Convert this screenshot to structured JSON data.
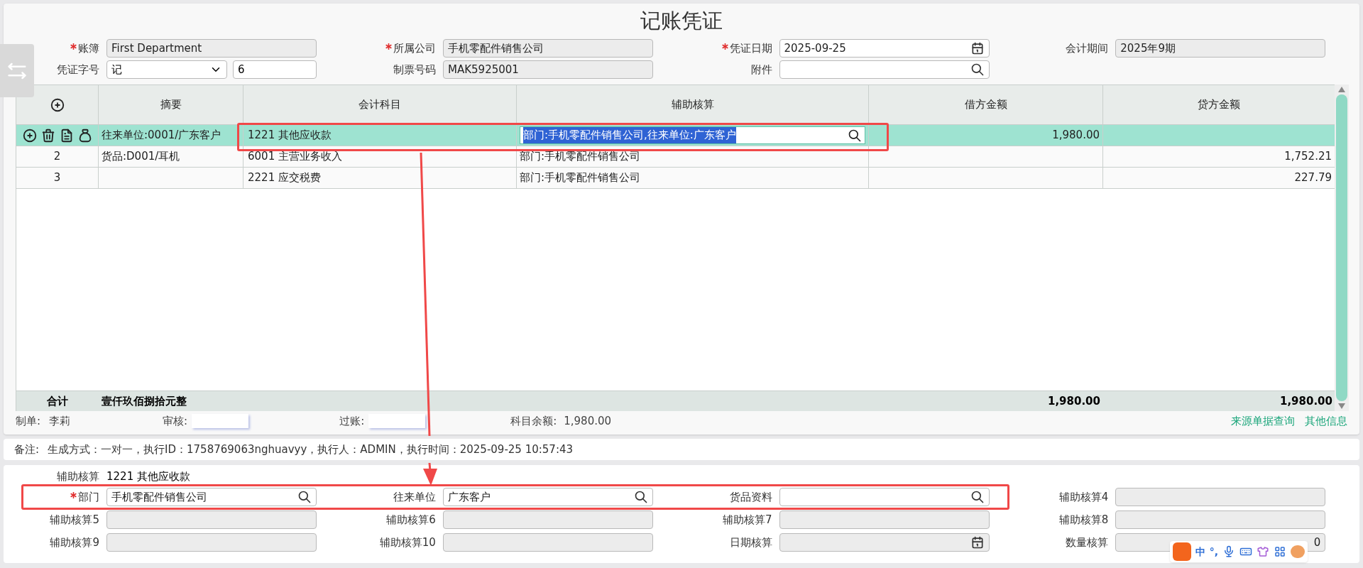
{
  "title": "记账凭证",
  "header_rows": [
    [
      {
        "label": "账簿",
        "required": true,
        "kind": "text",
        "disabled": true,
        "value": "First Department"
      },
      {
        "label": "所属公司",
        "required": true,
        "kind": "text",
        "disabled": true,
        "value": "手机零配件销售公司"
      },
      {
        "label": "凭证日期",
        "required": true,
        "kind": "date",
        "disabled": false,
        "value": "2025-09-25"
      },
      {
        "label": "会计期间",
        "required": false,
        "kind": "text",
        "disabled": true,
        "value": "2025年9期"
      }
    ],
    [
      {
        "label": "凭证字号",
        "required": false,
        "kind": "select_number",
        "disabled": false,
        "value": "记",
        "number": "6"
      },
      {
        "label": "制票号码",
        "required": false,
        "kind": "text",
        "disabled": true,
        "value": "MAK5925001"
      },
      {
        "label": "附件",
        "required": false,
        "kind": "lookup",
        "disabled": false
      }
    ]
  ],
  "table": {
    "columns": [
      "摘要",
      "会计科目",
      "辅助核算",
      "借方金额",
      "贷方金额"
    ],
    "rows": [
      {
        "selected": true,
        "index": "",
        "summary": "往来单位:0001/广东客户",
        "account": "1221 其他应收款",
        "aux": "部门:手机零配件销售公司,往来单位:广东客户",
        "debit": "1,980.00",
        "credit": ""
      },
      {
        "selected": false,
        "index": "2",
        "summary": "货品:D001/耳机",
        "account": "6001 主营业务收入",
        "aux": "部门:手机零配件销售公司",
        "debit": "",
        "credit": "1,752.21"
      },
      {
        "selected": false,
        "index": "3",
        "summary": "",
        "account": "2221 应交税费",
        "aux": "部门:手机零配件销售公司",
        "debit": "",
        "credit": "227.79"
      }
    ],
    "total": {
      "label": "合计",
      "words": "壹仟玖佰捌拾元整",
      "debit": "1,980.00",
      "credit": "1,980.00"
    }
  },
  "footer": {
    "maker_label": "制单:",
    "maker": "李莉",
    "review_label": "审核:",
    "post_label": "过账:",
    "balance_label": "科目余额:",
    "balance": "1,980.00",
    "links": [
      "来源单据查询",
      "其他信息"
    ]
  },
  "remarks": {
    "label": "备注:",
    "text": "生成方式：一对一，执行ID：1758769063nghuavyy，执行人：ADMIN，执行时间：2025-09-25 10:57:43"
  },
  "aux_panel": {
    "label": "辅助核算",
    "account": "1221 其他应收款",
    "rows": [
      [
        {
          "label": "部门",
          "required": true,
          "kind": "lookup",
          "disabled": false,
          "value": "手机零配件销售公司"
        },
        {
          "label": "往来单位",
          "required": false,
          "kind": "lookup",
          "disabled": false,
          "value": "广东客户"
        },
        {
          "label": "货品资料",
          "required": false,
          "kind": "lookup",
          "disabled": false
        },
        {
          "label": "辅助核算4",
          "required": false,
          "kind": "text",
          "disabled": true
        }
      ],
      [
        {
          "label": "辅助核算5",
          "required": false,
          "kind": "text",
          "disabled": true
        },
        {
          "label": "辅助核算6",
          "required": false,
          "kind": "text",
          "disabled": true
        },
        {
          "label": "辅助核算7",
          "required": false,
          "kind": "text",
          "disabled": true
        },
        {
          "label": "辅助核算8",
          "required": false,
          "kind": "text",
          "disabled": true
        }
      ],
      [
        {
          "label": "辅助核算9",
          "required": false,
          "kind": "text",
          "disabled": true
        },
        {
          "label": "辅助核算10",
          "required": false,
          "kind": "text",
          "disabled": true
        },
        {
          "label": "日期核算",
          "required": false,
          "kind": "date",
          "disabled": true
        },
        {
          "label": "数量核算",
          "required": false,
          "kind": "number",
          "disabled": true,
          "value": "0"
        }
      ]
    ]
  },
  "ime_bar": {
    "mode": "中",
    "punct": "°,"
  }
}
